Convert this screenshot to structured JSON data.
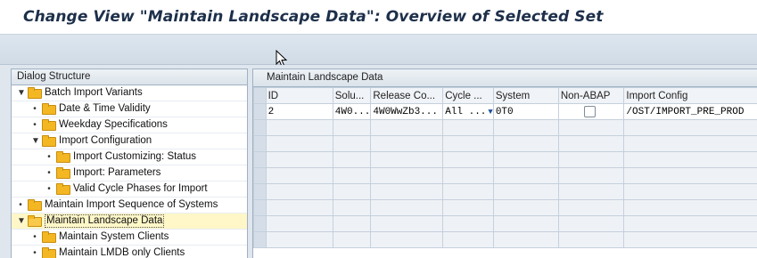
{
  "window": {
    "title": "Change View \"Maintain Landscape Data\": Overview of Selected Set"
  },
  "dialog_structure": {
    "header": "Dialog Structure",
    "items": [
      {
        "label": "Batch Import Variants",
        "level": 0,
        "expander": "▼"
      },
      {
        "label": "Date & Time Validity",
        "level": 1,
        "expander": "•"
      },
      {
        "label": "Weekday Specifications",
        "level": 1,
        "expander": "•"
      },
      {
        "label": "Import Configuration",
        "level": 1,
        "expander": "▼"
      },
      {
        "label": "Import Customizing: Status",
        "level": 2,
        "expander": "•"
      },
      {
        "label": "Import: Parameters",
        "level": 2,
        "expander": "•"
      },
      {
        "label": "Valid Cycle Phases for Import",
        "level": 2,
        "expander": "•"
      },
      {
        "label": "Maintain Import Sequence of Systems",
        "level": 0,
        "expander": "•"
      },
      {
        "label": "Maintain Landscape Data",
        "level": 0,
        "expander": "▼",
        "selected": true
      },
      {
        "label": "Maintain System Clients",
        "level": 1,
        "expander": "•"
      },
      {
        "label": "Maintain LMDB only Clients",
        "level": 1,
        "expander": "•"
      }
    ]
  },
  "table": {
    "title": "Maintain Landscape Data",
    "columns": [
      "ID",
      "Solu...",
      "Release Co...",
      "Cycle ...",
      "System",
      "Non-ABAP",
      "Import Config"
    ],
    "rows": [
      {
        "id": "2",
        "solution": "4W0...",
        "release": "4W0WwZb3...",
        "cycle": "All  ...",
        "system": "0T0",
        "non_abap": false,
        "import_config": "/OST/IMPORT_PRE_PROD"
      }
    ],
    "empty_rows": 8
  },
  "colors": {
    "title_text": "#1d2f4a",
    "folder": "#f3b723",
    "selected_row": "#fff7c8"
  }
}
